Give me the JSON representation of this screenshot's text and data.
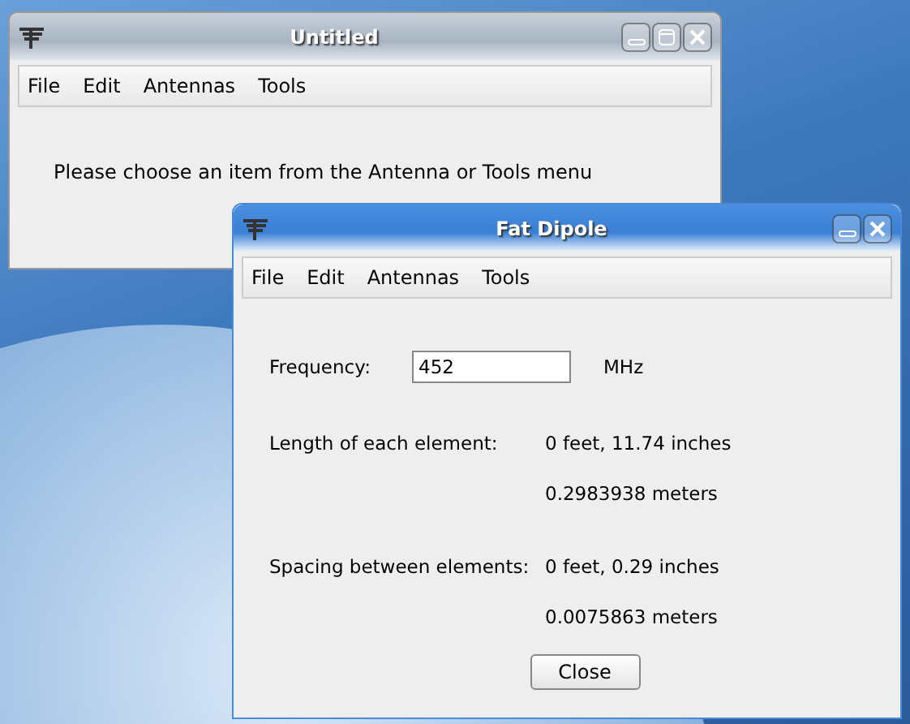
{
  "windows": [
    {
      "title": "Untitled",
      "maximizable": true,
      "active": false,
      "menu": [
        "File",
        "Edit",
        "Antennas",
        "Tools"
      ],
      "message": "Please choose an item from the Antenna or Tools menu"
    },
    {
      "title": "Fat Dipole",
      "maximizable": false,
      "active": true,
      "menu": [
        "File",
        "Edit",
        "Antennas",
        "Tools"
      ],
      "frequency": {
        "label": "Frequency:",
        "value": "452",
        "unit": "MHz"
      },
      "results": [
        {
          "label": "Length of each element:",
          "lines": [
            "0 feet, 11.74 inches",
            "0.2983938 meters"
          ]
        },
        {
          "label": "Spacing between elements:",
          "lines": [
            "0 feet, 0.29 inches",
            "0.0075863 meters"
          ]
        }
      ],
      "close_button": "Close"
    }
  ]
}
